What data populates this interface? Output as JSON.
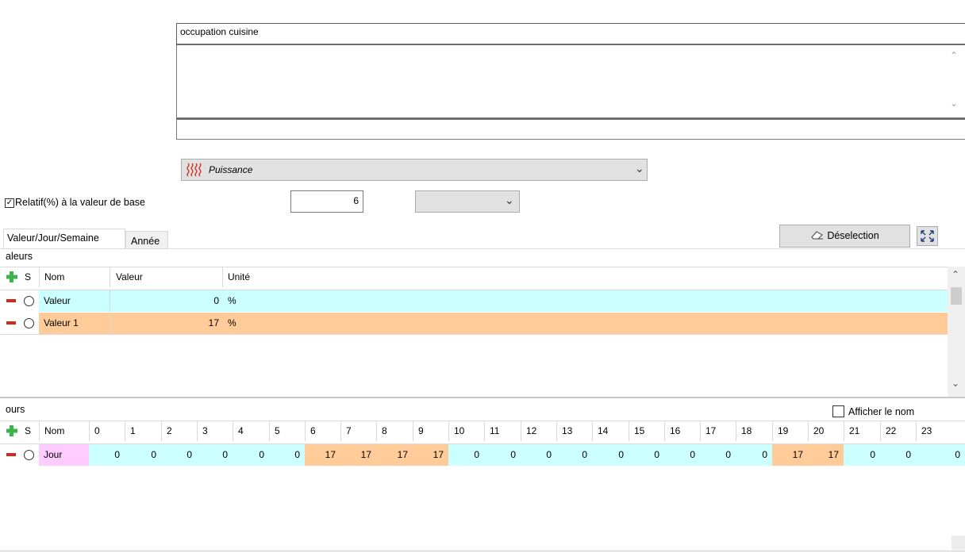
{
  "top": {
    "name_value": "occupation cuisine",
    "desc_value": "",
    "extra_value": ""
  },
  "puissance": {
    "label": "Puissance",
    "icon": "heat-waves-icon",
    "icon_color": "#d12a1c"
  },
  "relatif": {
    "checked": true,
    "label": "Relatif(%) à la valeur de base",
    "base_value": "6",
    "select_value": ""
  },
  "tabs": [
    {
      "label": "Valeur/Jour/Semaine",
      "active": true
    },
    {
      "label": "Année",
      "active": false
    }
  ],
  "buttons": {
    "deselect_label": "Déselection",
    "deselect_icon": "eraser-icon",
    "expand_icon": "expand-arrows-icon"
  },
  "valeurs": {
    "title": "aleurs",
    "headers": {
      "s": "S",
      "nom": "Nom",
      "valeur": "Valeur",
      "unite": "Unité"
    },
    "rows": [
      {
        "nom": "Valeur",
        "valeur": "0",
        "unite": "%",
        "color": "#ccffff"
      },
      {
        "nom": "Valeur 1",
        "valeur": "17",
        "unite": "%",
        "color": "#ffcc99"
      }
    ]
  },
  "jours": {
    "title": "ours",
    "afficher_label": "Afficher le nom",
    "headers": {
      "s": "S",
      "nom": "Nom",
      "hours": [
        "0",
        "1",
        "2",
        "3",
        "4",
        "5",
        "6",
        "7",
        "8",
        "9",
        "10",
        "11",
        "12",
        "13",
        "14",
        "15",
        "16",
        "17",
        "18",
        "19",
        "20",
        "21",
        "22",
        "23"
      ]
    },
    "rows": [
      {
        "nom": "Jour",
        "nom_color": "#ffccff",
        "values": [
          "0",
          "0",
          "0",
          "0",
          "0",
          "0",
          "17",
          "17",
          "17",
          "17",
          "0",
          "0",
          "0",
          "0",
          "0",
          "0",
          "0",
          "0",
          "0",
          "17",
          "17",
          "0",
          "0",
          "0"
        ]
      }
    ]
  },
  "colors": {
    "zero": "#ccffff",
    "seventeen": "#ffcc99",
    "accent_green": "#3cb44b",
    "accent_red": "#d12a1c"
  }
}
